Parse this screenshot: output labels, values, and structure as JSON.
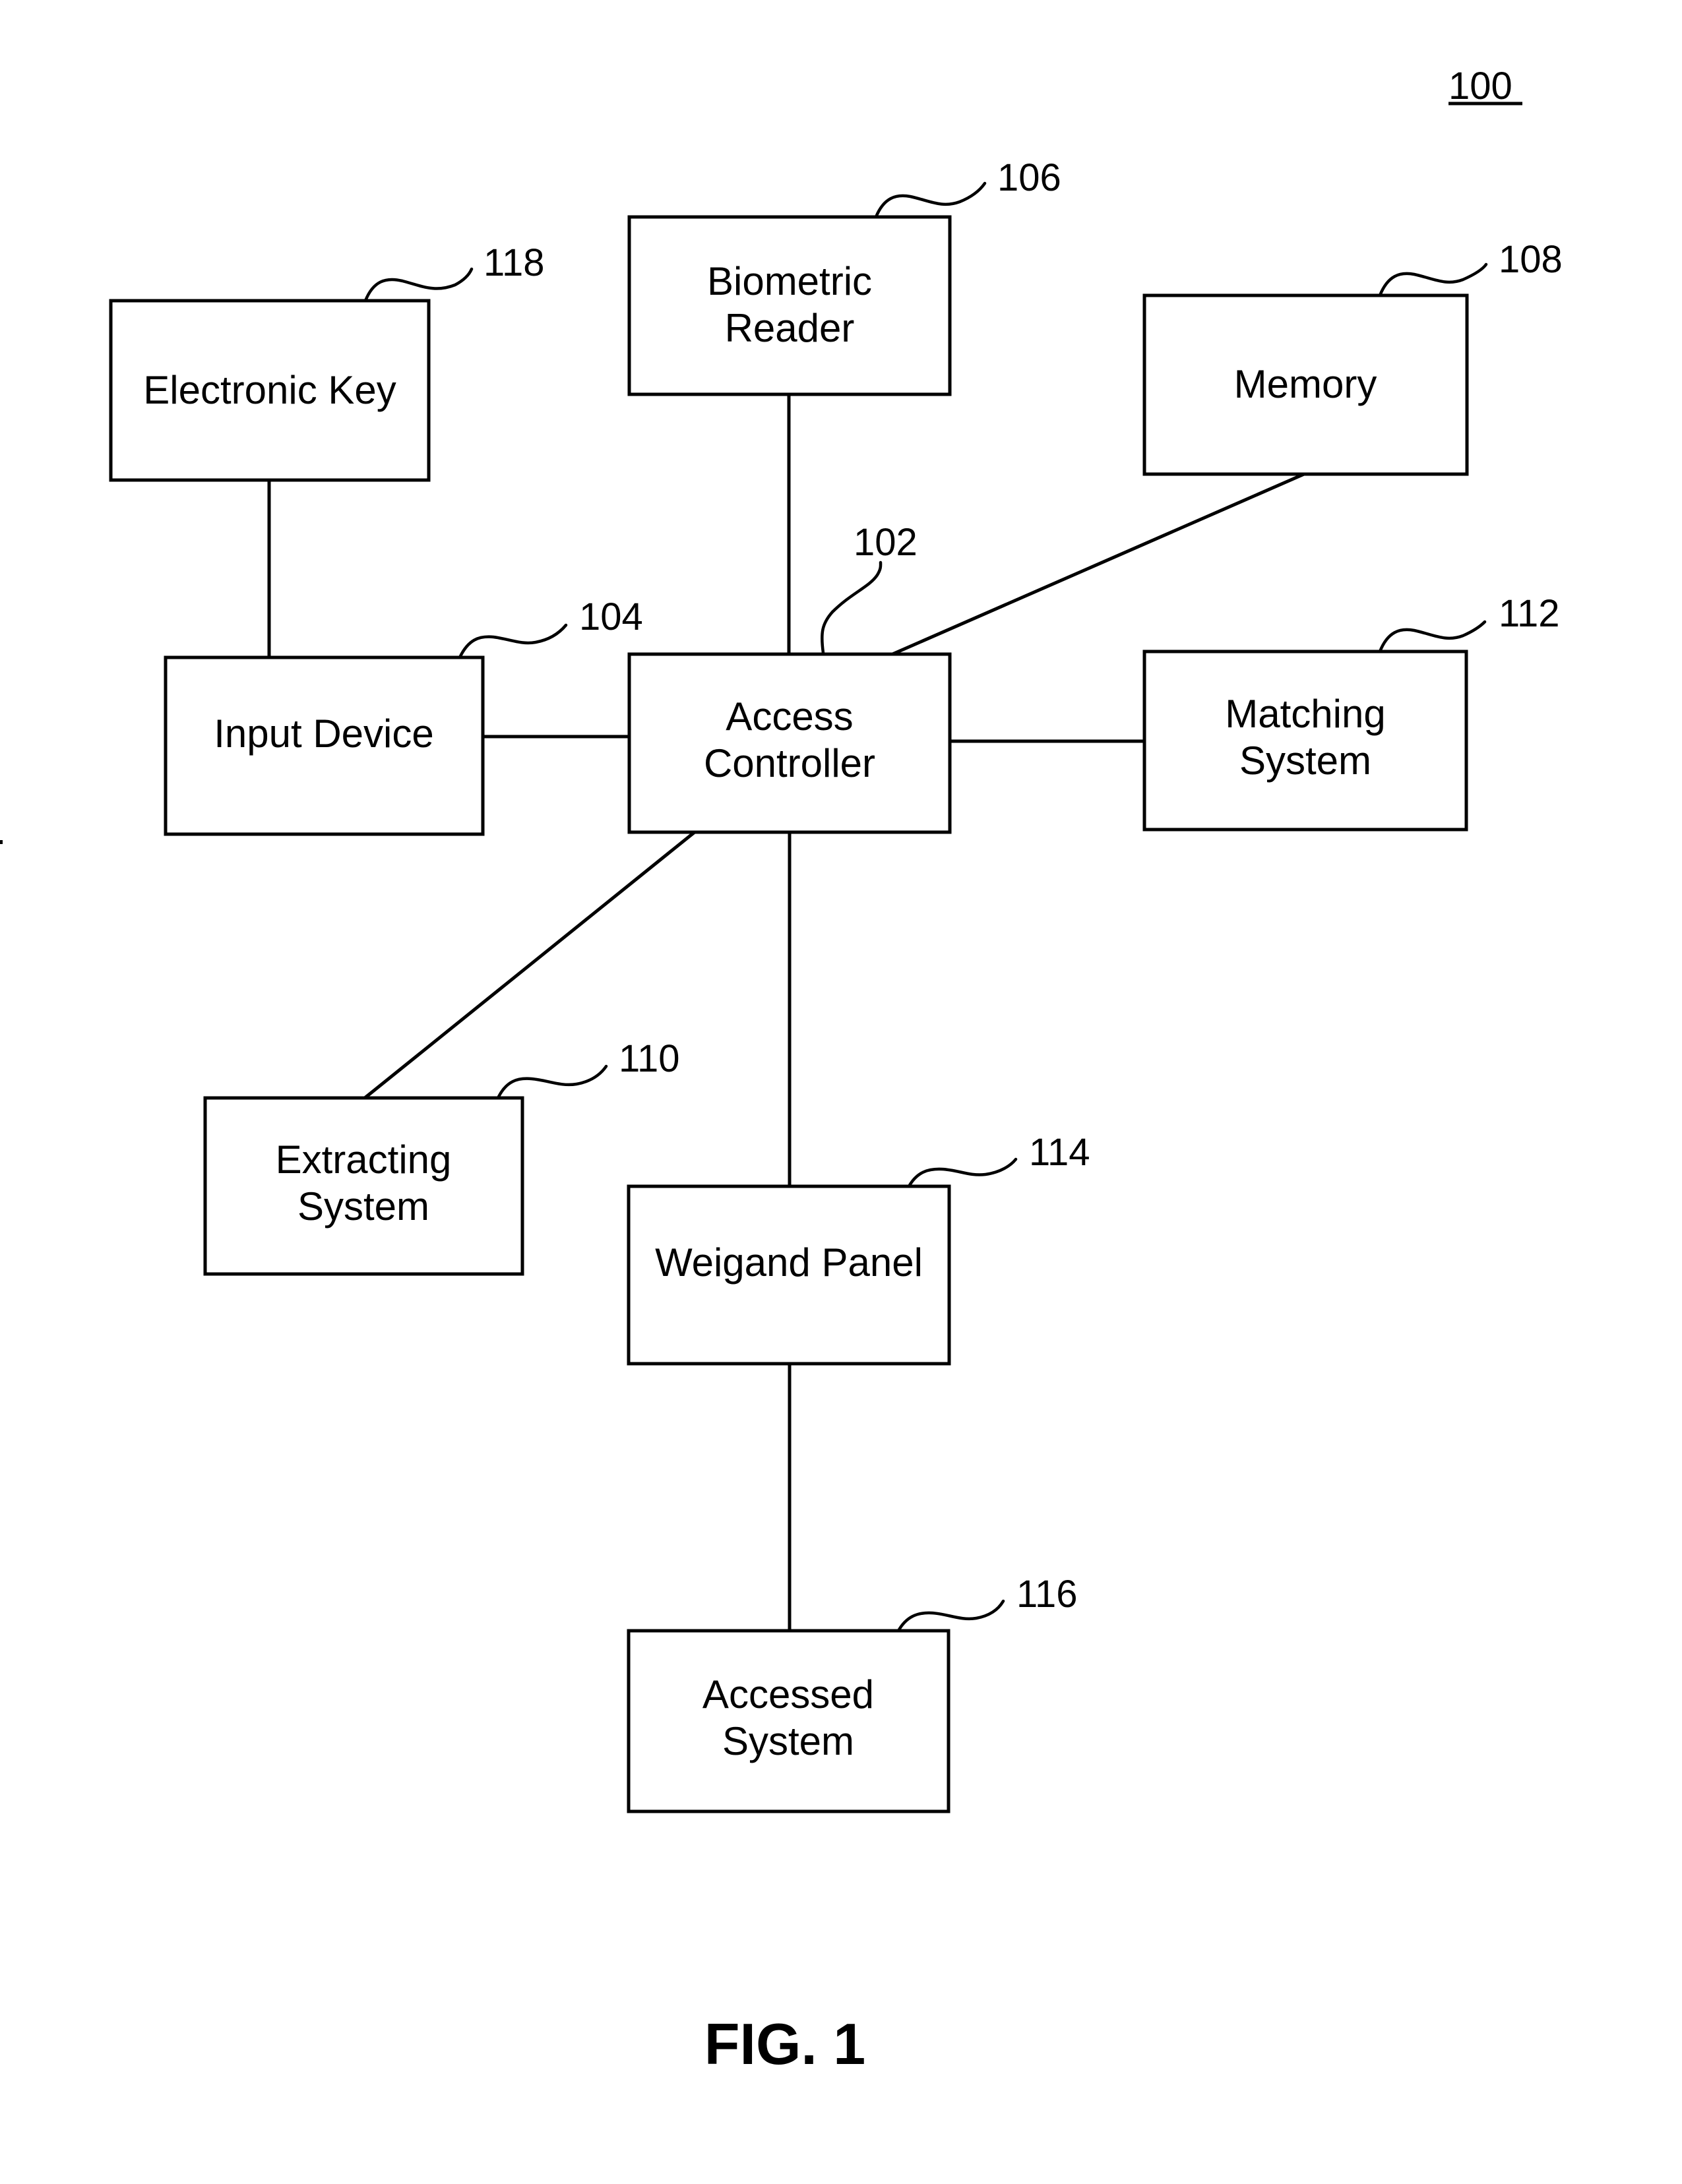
{
  "figure": {
    "system_ref": "100",
    "caption": "FIG. 1"
  },
  "blocks": {
    "access_controller": {
      "ref": "102",
      "lines": [
        "Access",
        "Controller"
      ]
    },
    "input_device": {
      "ref": "104",
      "lines": [
        "Input Device"
      ]
    },
    "biometric_reader": {
      "ref": "106",
      "lines": [
        "Biometric",
        "Reader"
      ]
    },
    "memory": {
      "ref": "108",
      "lines": [
        "Memory"
      ]
    },
    "extracting_system": {
      "ref": "110",
      "lines": [
        "Extracting",
        "System"
      ]
    },
    "matching_system": {
      "ref": "112",
      "lines": [
        "Matching",
        "System"
      ]
    },
    "weigand_panel": {
      "ref": "114",
      "lines": [
        "Weigand Panel"
      ]
    },
    "accessed_system": {
      "ref": "116",
      "lines": [
        "Accessed",
        "System"
      ]
    },
    "electronic_key": {
      "ref": "118",
      "lines": [
        "Electronic Key"
      ]
    }
  },
  "connections": [
    [
      "electronic_key",
      "input_device"
    ],
    [
      "biometric_reader",
      "access_controller"
    ],
    [
      "memory",
      "access_controller"
    ],
    [
      "input_device",
      "access_controller"
    ],
    [
      "access_controller",
      "matching_system"
    ],
    [
      "access_controller",
      "extracting_system"
    ],
    [
      "access_controller",
      "weigand_panel"
    ],
    [
      "weigand_panel",
      "accessed_system"
    ]
  ]
}
